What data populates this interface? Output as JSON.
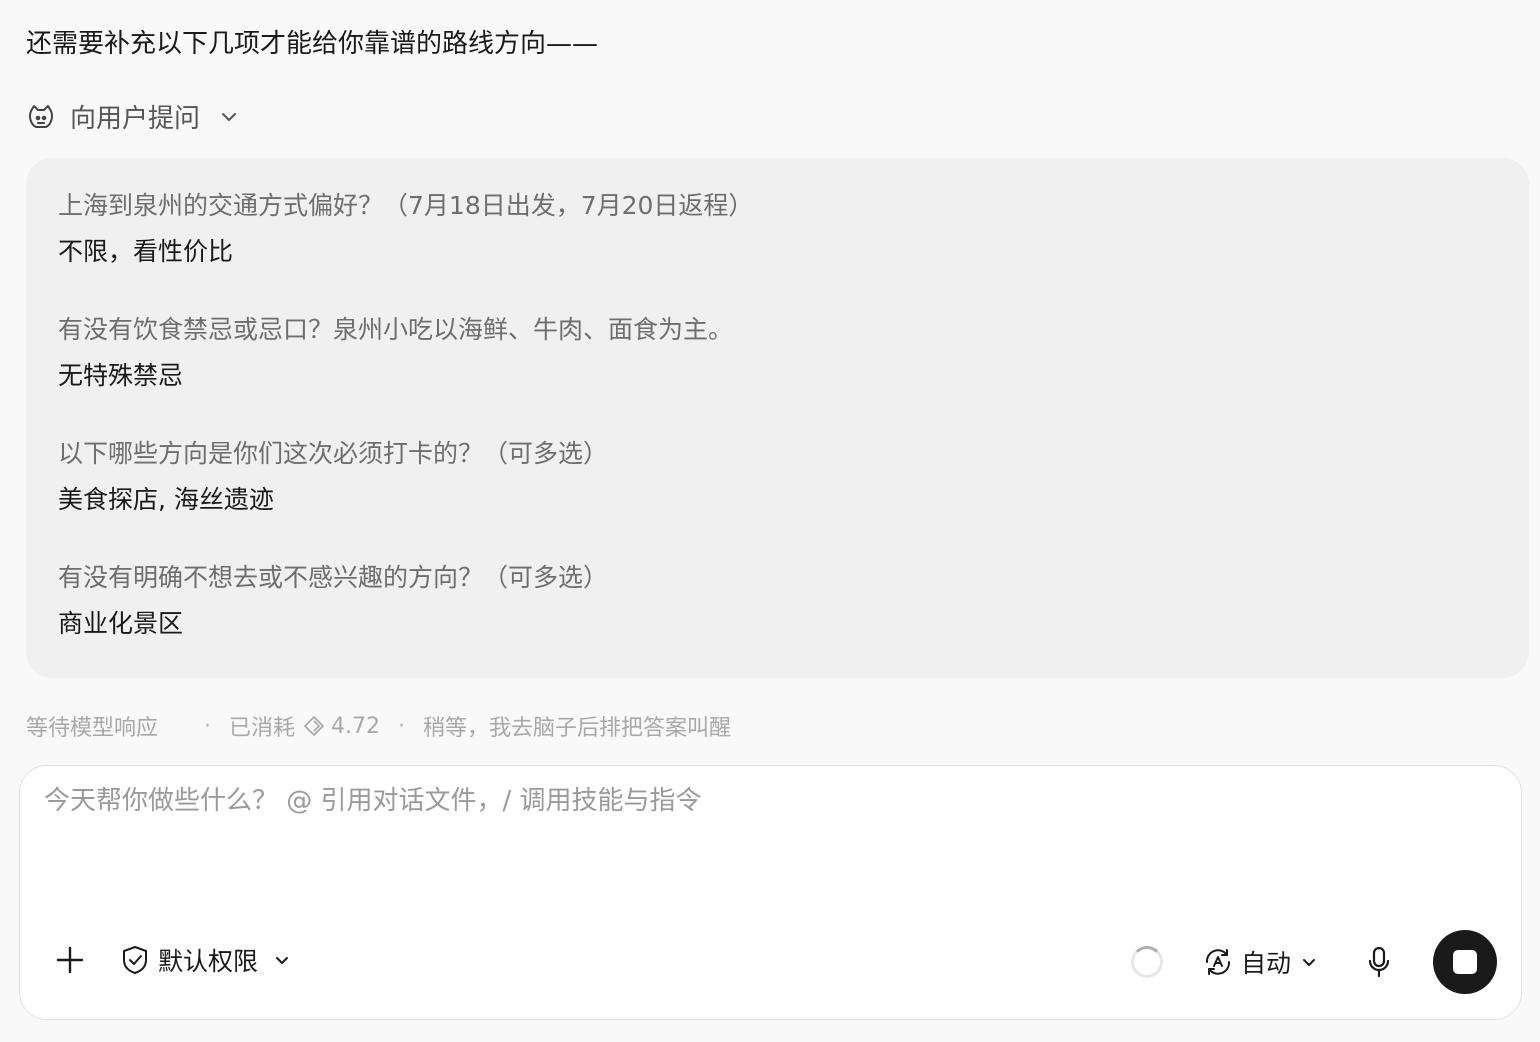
{
  "message": {
    "intro": "还需要补充以下几项才能给你靠谱的路线方向——"
  },
  "ask_user": {
    "title": "向用户提问",
    "items": [
      {
        "question": "上海到泉州的交通方式偏好？（7月18日出发，7月20日返程）",
        "answer": "不限，看性价比"
      },
      {
        "question": "有没有饮食禁忌或忌口？泉州小吃以海鲜、牛肉、面食为主。",
        "answer": "无特殊禁忌"
      },
      {
        "question": "以下哪些方向是你们这次必须打卡的？（可多选）",
        "answer": "美食探店, 海丝遗迹"
      },
      {
        "question": "有没有明确不想去或不感兴趣的方向？（可多选）",
        "answer": "商业化景区"
      }
    ]
  },
  "status": {
    "waiting": "等待模型响应",
    "consumed_label": "已消耗",
    "consumed_value": "4.72",
    "message": "稍等，我去脑子后排把答案叫醒"
  },
  "composer": {
    "placeholder": "今天帮你做些什么？ @ 引用对话文件，/ 调用技能与指令",
    "permission_label": "默认权限",
    "mode_label": "自动"
  },
  "icons": {
    "ask": "robot-face-icon",
    "chevron": "chevron-down-icon",
    "diamond": "diamond-icon",
    "plus": "plus-icon",
    "shield": "shield-check-icon",
    "mode": "auto-mode-icon",
    "mic": "microphone-icon",
    "stop": "stop-icon"
  }
}
